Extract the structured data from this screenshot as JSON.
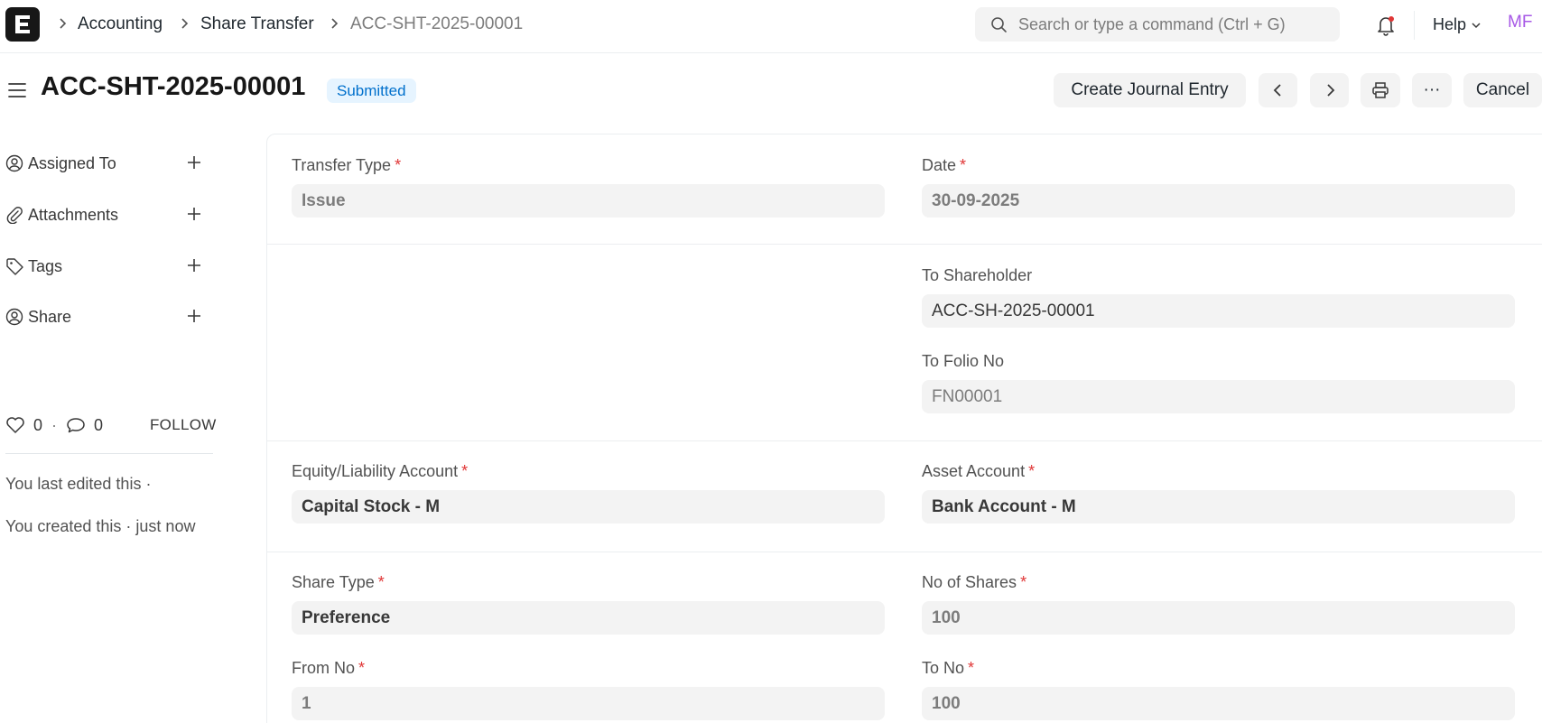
{
  "navbar": {
    "breadcrumbs": [
      "Accounting",
      "Share Transfer",
      "ACC-SHT-2025-00001"
    ],
    "search_placeholder": "Search or type a command (Ctrl + G)",
    "help_label": "Help",
    "avatar_initials": "MF"
  },
  "page": {
    "title": "ACC-SHT-2025-00001",
    "status": "Submitted"
  },
  "actions": {
    "create_journal_label": "Create Journal Entry",
    "more_label": "···",
    "cancel_label": "Cancel"
  },
  "sidebar": {
    "items": [
      {
        "label": "Assigned To",
        "icon": "add-user-icon"
      },
      {
        "label": "Attachments",
        "icon": "paperclip-icon"
      },
      {
        "label": "Tags",
        "icon": "tag-icon"
      },
      {
        "label": "Share",
        "icon": "share-user-icon"
      }
    ],
    "likes": "0",
    "comments": "0",
    "follow_label": "FOLLOW",
    "last_edited": "You last edited this ·",
    "created": "You created this · just now"
  },
  "form": {
    "transfer_type": {
      "label": "Transfer Type",
      "value": "Issue"
    },
    "date": {
      "label": "Date",
      "value": "30-09-2025"
    },
    "to_shareholder": {
      "label": "To Shareholder",
      "value": "ACC-SH-2025-00001"
    },
    "to_folio_no": {
      "label": "To Folio No",
      "value": "FN00001"
    },
    "equity_account": {
      "label": "Equity/Liability Account",
      "value": "Capital Stock - M"
    },
    "asset_account": {
      "label": "Asset Account",
      "value": "Bank Account - M"
    },
    "share_type": {
      "label": "Share Type",
      "value": "Preference"
    },
    "no_of_shares": {
      "label": "No of Shares",
      "value": "100"
    },
    "from_no": {
      "label": "From No",
      "value": "1"
    },
    "to_no": {
      "label": "To No",
      "value": "100"
    }
  },
  "colors": {
    "accent": "#0070cc",
    "badge_bg": "#e6f4ff",
    "required": "#e03636",
    "avatar": "#a758e6"
  }
}
